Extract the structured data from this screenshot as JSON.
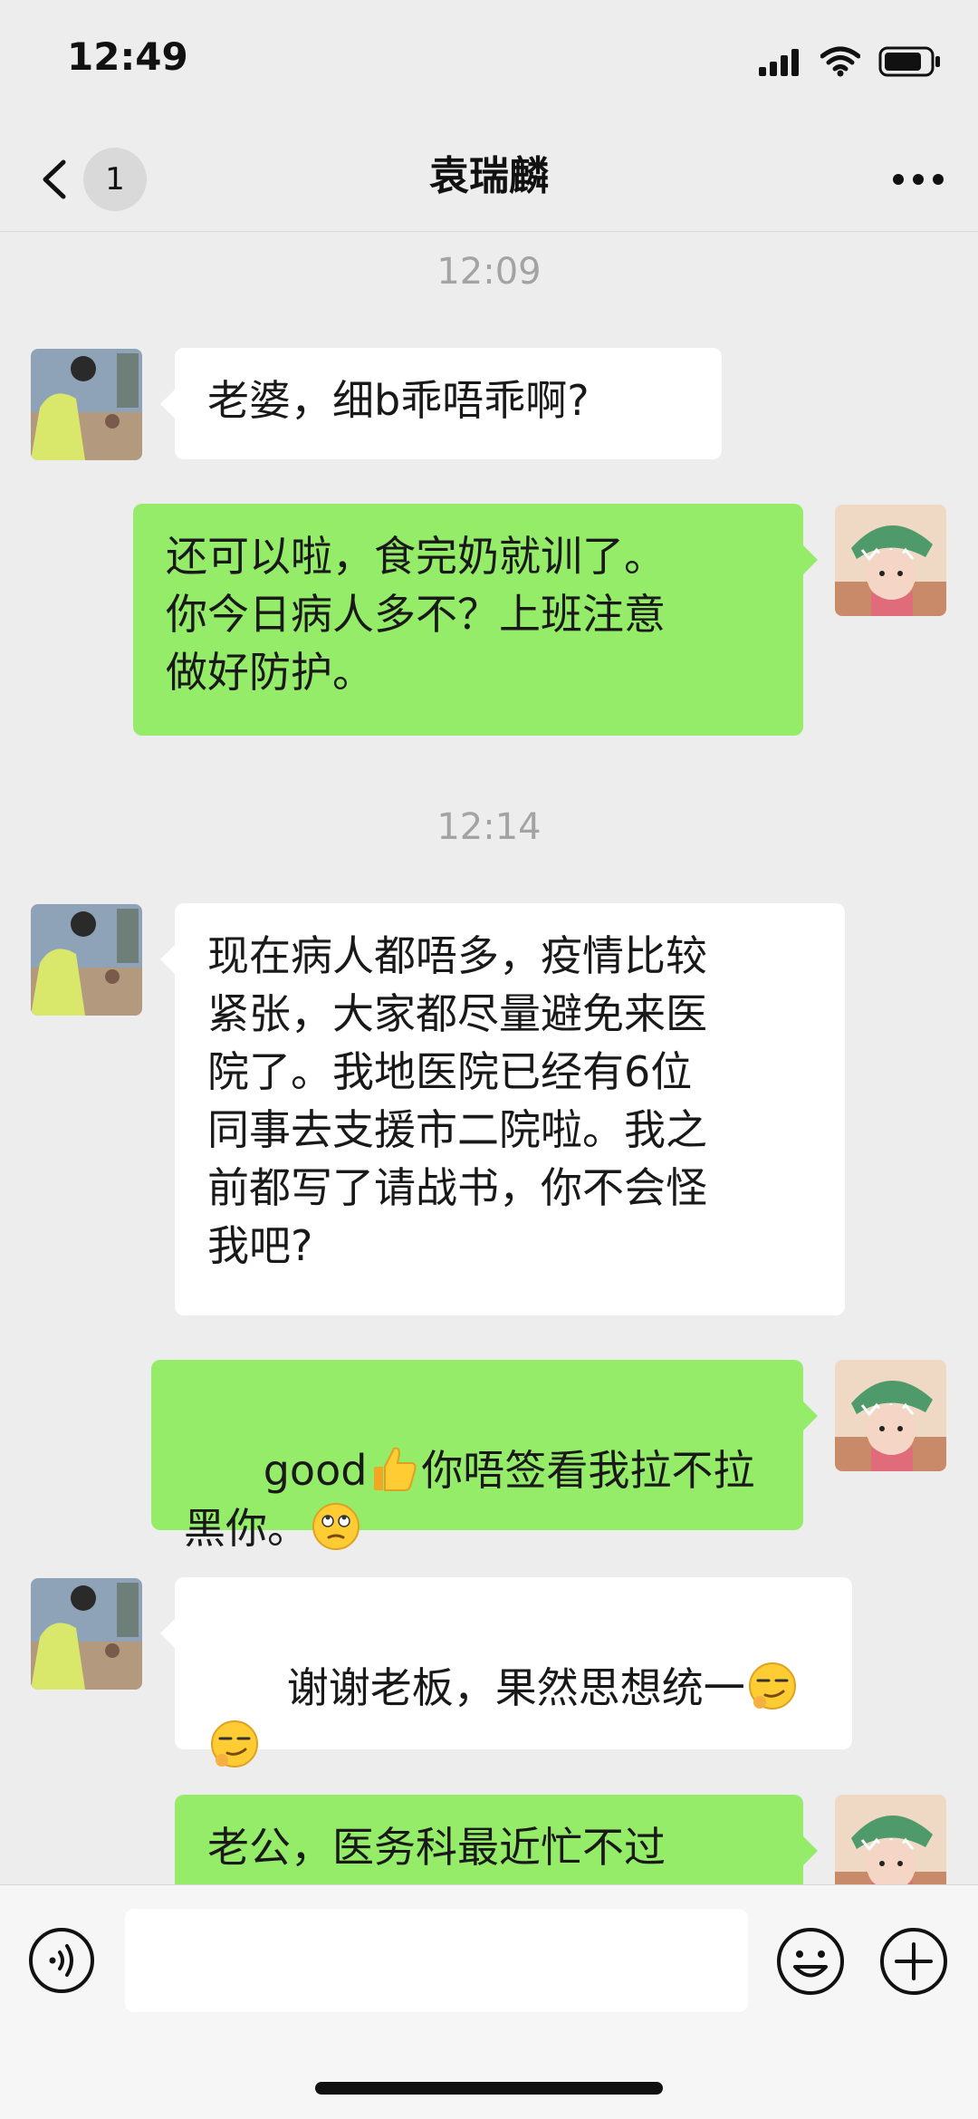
{
  "status_bar": {
    "time": "12:49"
  },
  "header": {
    "back_badge": "1",
    "title": "袁瑞麟"
  },
  "timestamps": [
    "12:09",
    "12:14"
  ],
  "messages": [
    {
      "from": "other",
      "text": "老婆，细b乖唔乖啊?"
    },
    {
      "from": "me",
      "text": "还可以啦，食完奶就训了。\n你今日病人多不？上班注意\n做好防护。"
    },
    {
      "from": "other",
      "text": "现在病人都唔多，疫情比较\n紧张，大家都尽量避免来医\n院了。我地医院已经有6位\n同事去支援市二院啦。我之\n前都写了请战书，你不会怪\n我吧?"
    },
    {
      "from": "me",
      "text_a": "good",
      "text_b": "你唔签看我拉不拉\n黑你。",
      "emoji_a": "thumbs-up-emoji",
      "emoji_b": "eye-roll-emoji"
    },
    {
      "from": "other",
      "text": "谢谢老板，果然思想统一",
      "emoji": "smirk-emoji"
    },
    {
      "from": "me",
      "text": "老公，医务科最近忙不过"
    }
  ],
  "colors": {
    "background": "#ededed",
    "bubble_in": "#ffffff",
    "bubble_out": "#95ec69",
    "timestamp": "#a3a3a3"
  }
}
